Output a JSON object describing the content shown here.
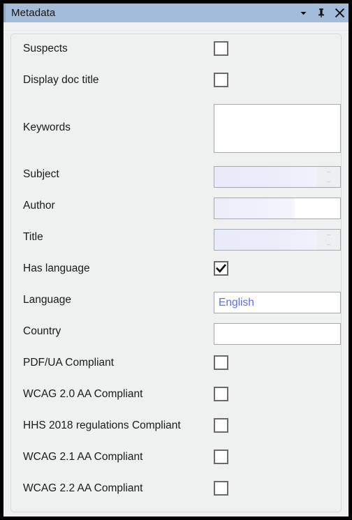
{
  "window": {
    "title": "Metadata",
    "controls": [
      {
        "name": "dropdown-chevron",
        "icon": "chevron-down-icon",
        "label": "▾"
      },
      {
        "name": "auto-hide-pin",
        "icon": "pin-icon",
        "label": "⚐"
      },
      {
        "name": "close",
        "icon": "close-icon",
        "label": "✕"
      }
    ]
  },
  "accent_color": "#a3bcd9",
  "body_color": "#eff0f0",
  "value_text_color": "#5b6fe8",
  "form": {
    "rows": [
      {
        "label": "Suspects",
        "type": "checkbox",
        "checked": false
      },
      {
        "label": "Display doc title",
        "type": "checkbox",
        "checked": false
      },
      {
        "label": "Keywords",
        "type": "textarea",
        "value": "",
        "placeholder": ""
      },
      {
        "label": "Subject",
        "type": "text-tinted-spin",
        "value": "",
        "placeholder": ""
      },
      {
        "label": "Author",
        "type": "text-split",
        "value": "",
        "placeholder": ""
      },
      {
        "label": "Title",
        "type": "text-tinted-spin",
        "value": "",
        "placeholder": ""
      },
      {
        "label": "Has language",
        "type": "checkbox",
        "checked": true
      },
      {
        "label": "Language",
        "type": "text",
        "value": "English",
        "placeholder": ""
      },
      {
        "label": "Country",
        "type": "text",
        "value": "",
        "placeholder": ""
      },
      {
        "label": "PDF/UA Compliant",
        "type": "checkbox",
        "checked": false
      },
      {
        "label": "WCAG 2.0 AA Compliant",
        "type": "checkbox",
        "checked": false
      },
      {
        "label": "HHS 2018 regulations Compliant",
        "type": "checkbox",
        "checked": false
      },
      {
        "label": "WCAG 2.1 AA Compliant",
        "type": "checkbox",
        "checked": false
      },
      {
        "label": "WCAG 2.2 AA Compliant",
        "type": "checkbox",
        "checked": false
      }
    ]
  }
}
